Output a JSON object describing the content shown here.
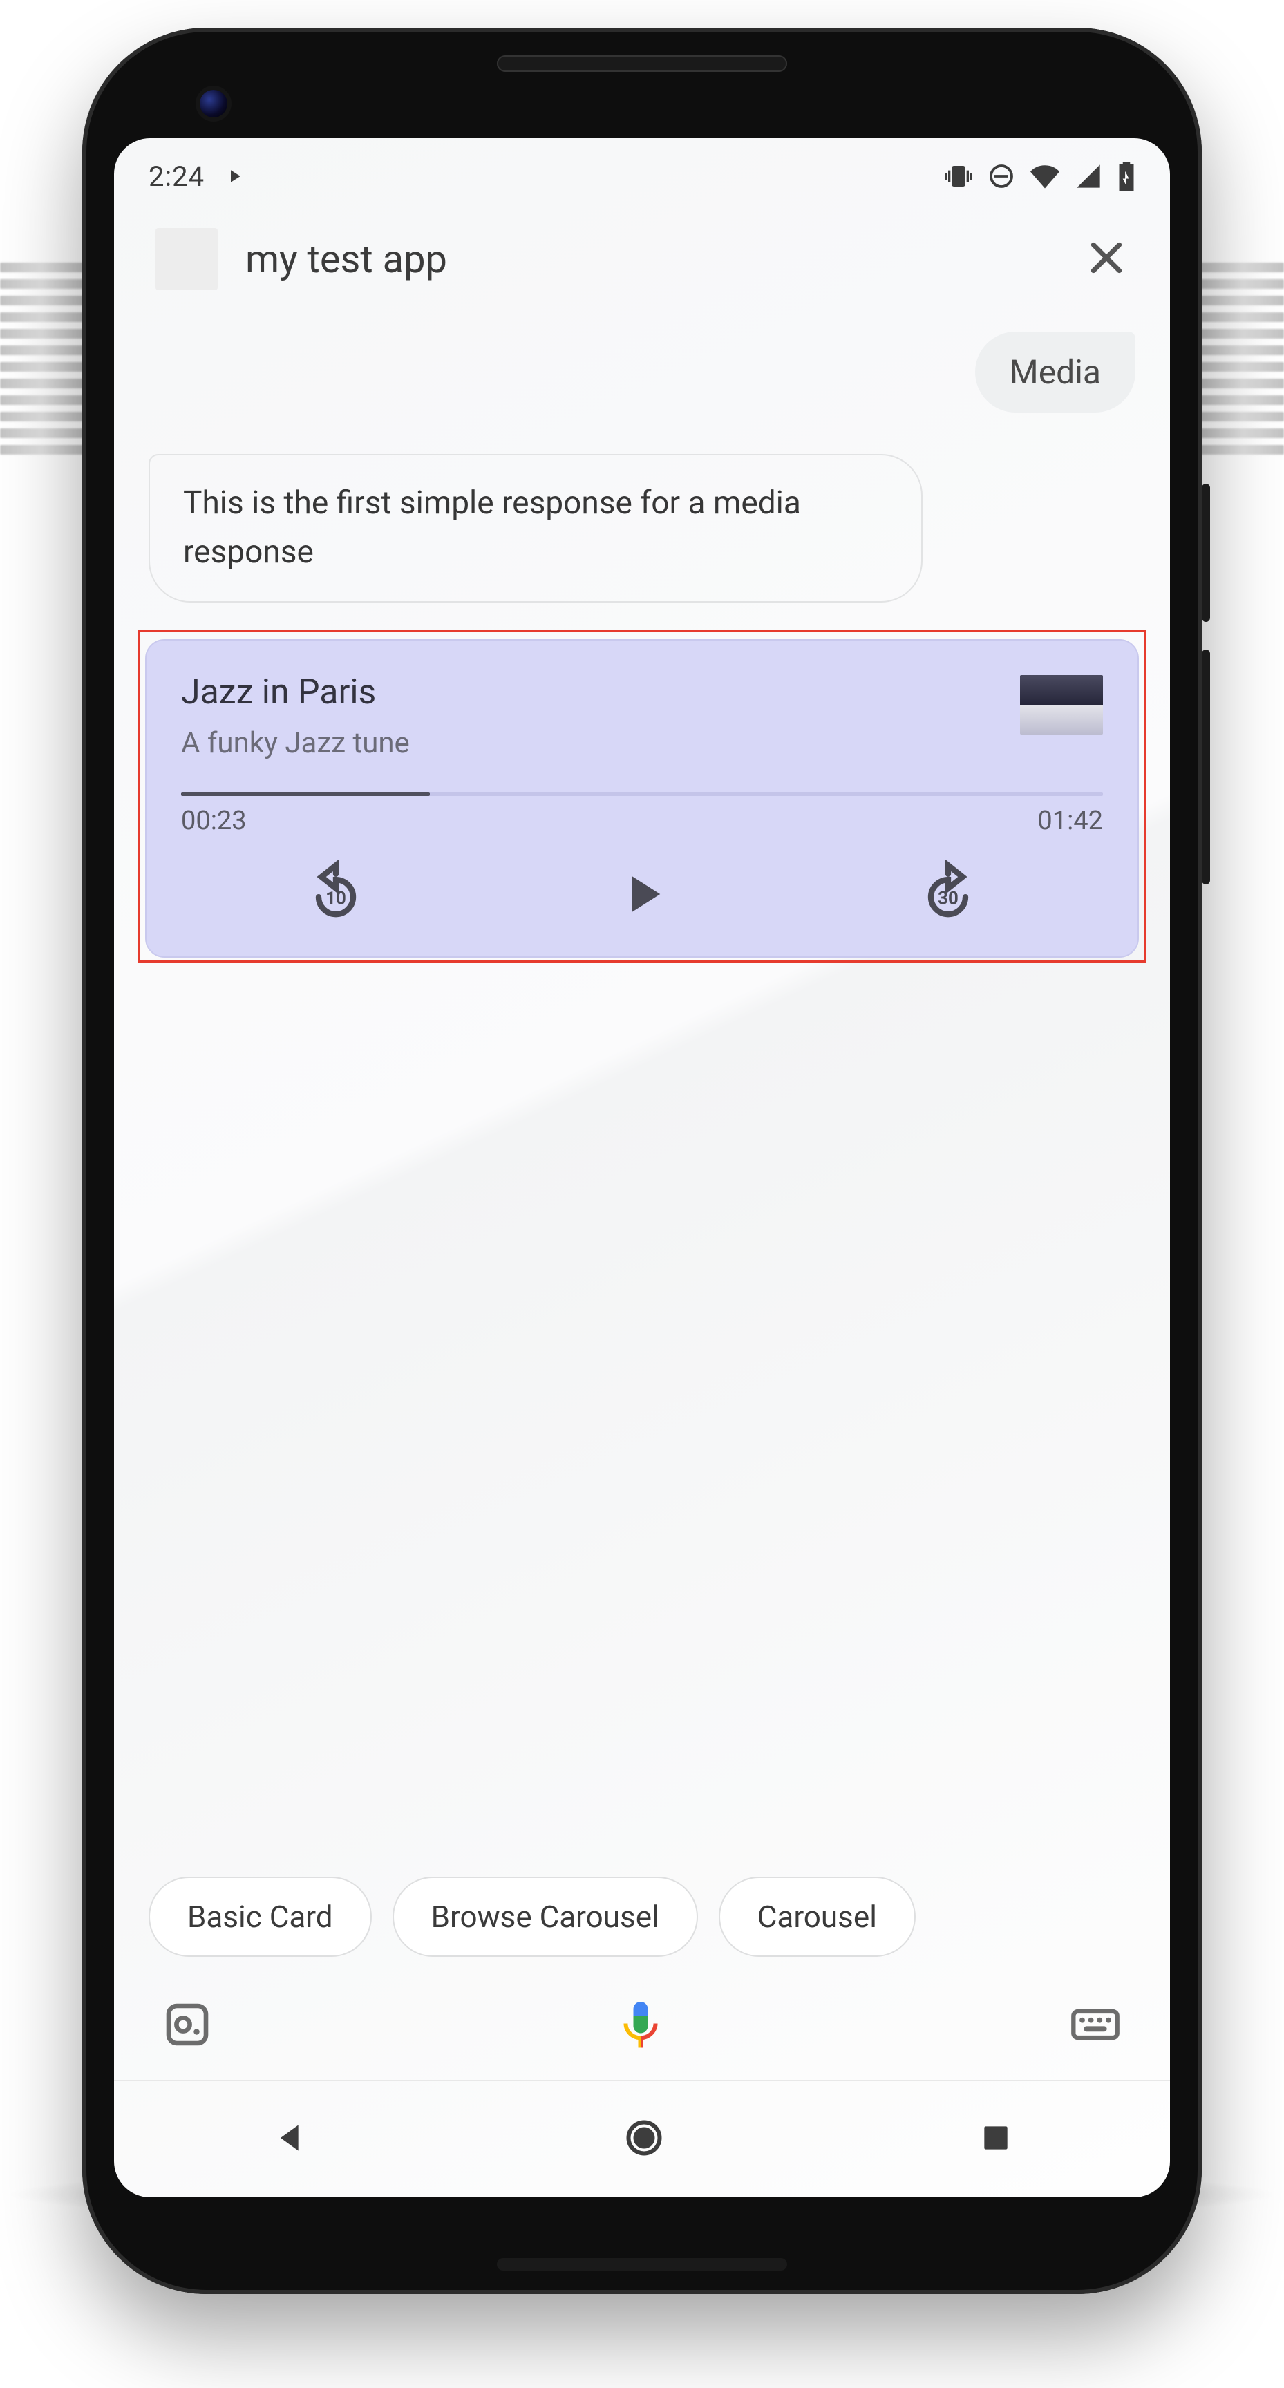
{
  "statusbar": {
    "time": "2:24"
  },
  "header": {
    "app_title": "my test app"
  },
  "chat": {
    "user_msg": "Media",
    "bot_msg": "This is the first simple response for a media response"
  },
  "media": {
    "title": "Jazz in Paris",
    "subtitle": "A funky Jazz tune",
    "elapsed": "00:23",
    "total": "01:42",
    "rewind_label": "10",
    "forward_label": "30",
    "progress_pct": 27
  },
  "chips": [
    "Basic Card",
    "Browse Carousel",
    "Carousel"
  ]
}
